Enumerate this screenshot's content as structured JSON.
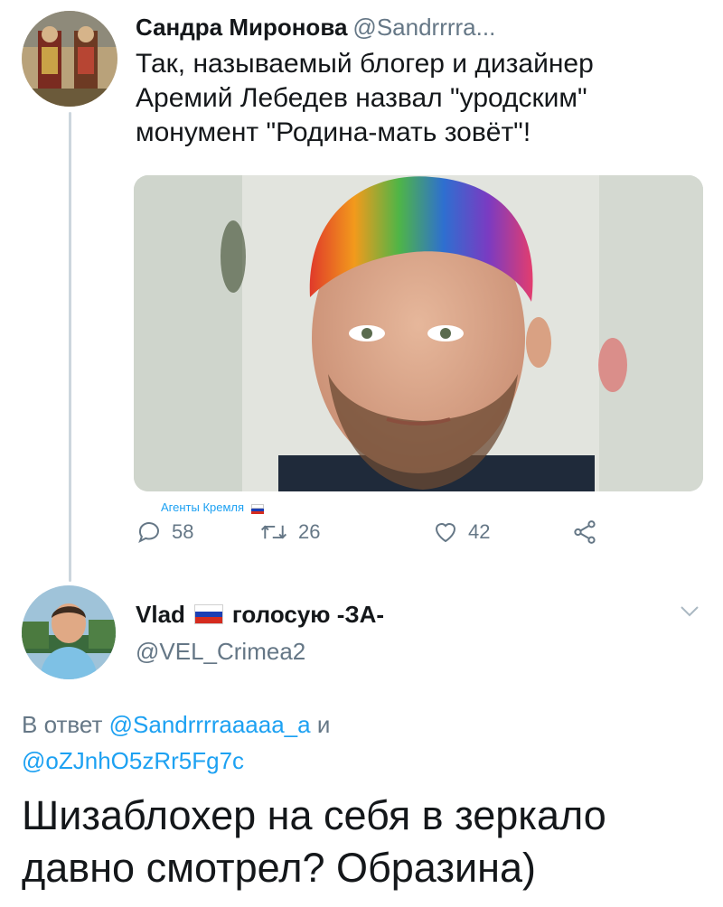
{
  "tweet": {
    "display_name": "Сандра Миронова",
    "handle": "@Sandrrrra...",
    "text": "Так, называемый блогер и дизайнер Аремий Лебедев назвал \"уродским\" монумент \"Родина-мать зовёт\"!",
    "watermark": "Агенты Кремля",
    "actions": {
      "replies": "58",
      "retweets": "26",
      "likes": "42"
    }
  },
  "reply": {
    "display_name": "Vlad",
    "name_suffix": "голосую -ЗА-",
    "handle": "@VEL_Crimea2",
    "reply_prefix": "В ответ",
    "mention_1": "@Sandrrrraaaaa_a",
    "conjunction": "и",
    "mention_2": "@oZJnhO5zRr5Fg7c",
    "text": "Шизаблохер на себя в зеркало давно смотрел? Образина)"
  },
  "colors": {
    "accent": "#1da1f2",
    "secondary_text": "#657786",
    "primary_text": "#14171a",
    "thread_line": "#ccd6dd"
  },
  "icons": {
    "reply": "reply-icon",
    "retweet": "retweet-icon",
    "like": "heart-icon",
    "share": "share-icon",
    "more": "chevron-down-icon",
    "flag": "russia-flag-icon"
  }
}
